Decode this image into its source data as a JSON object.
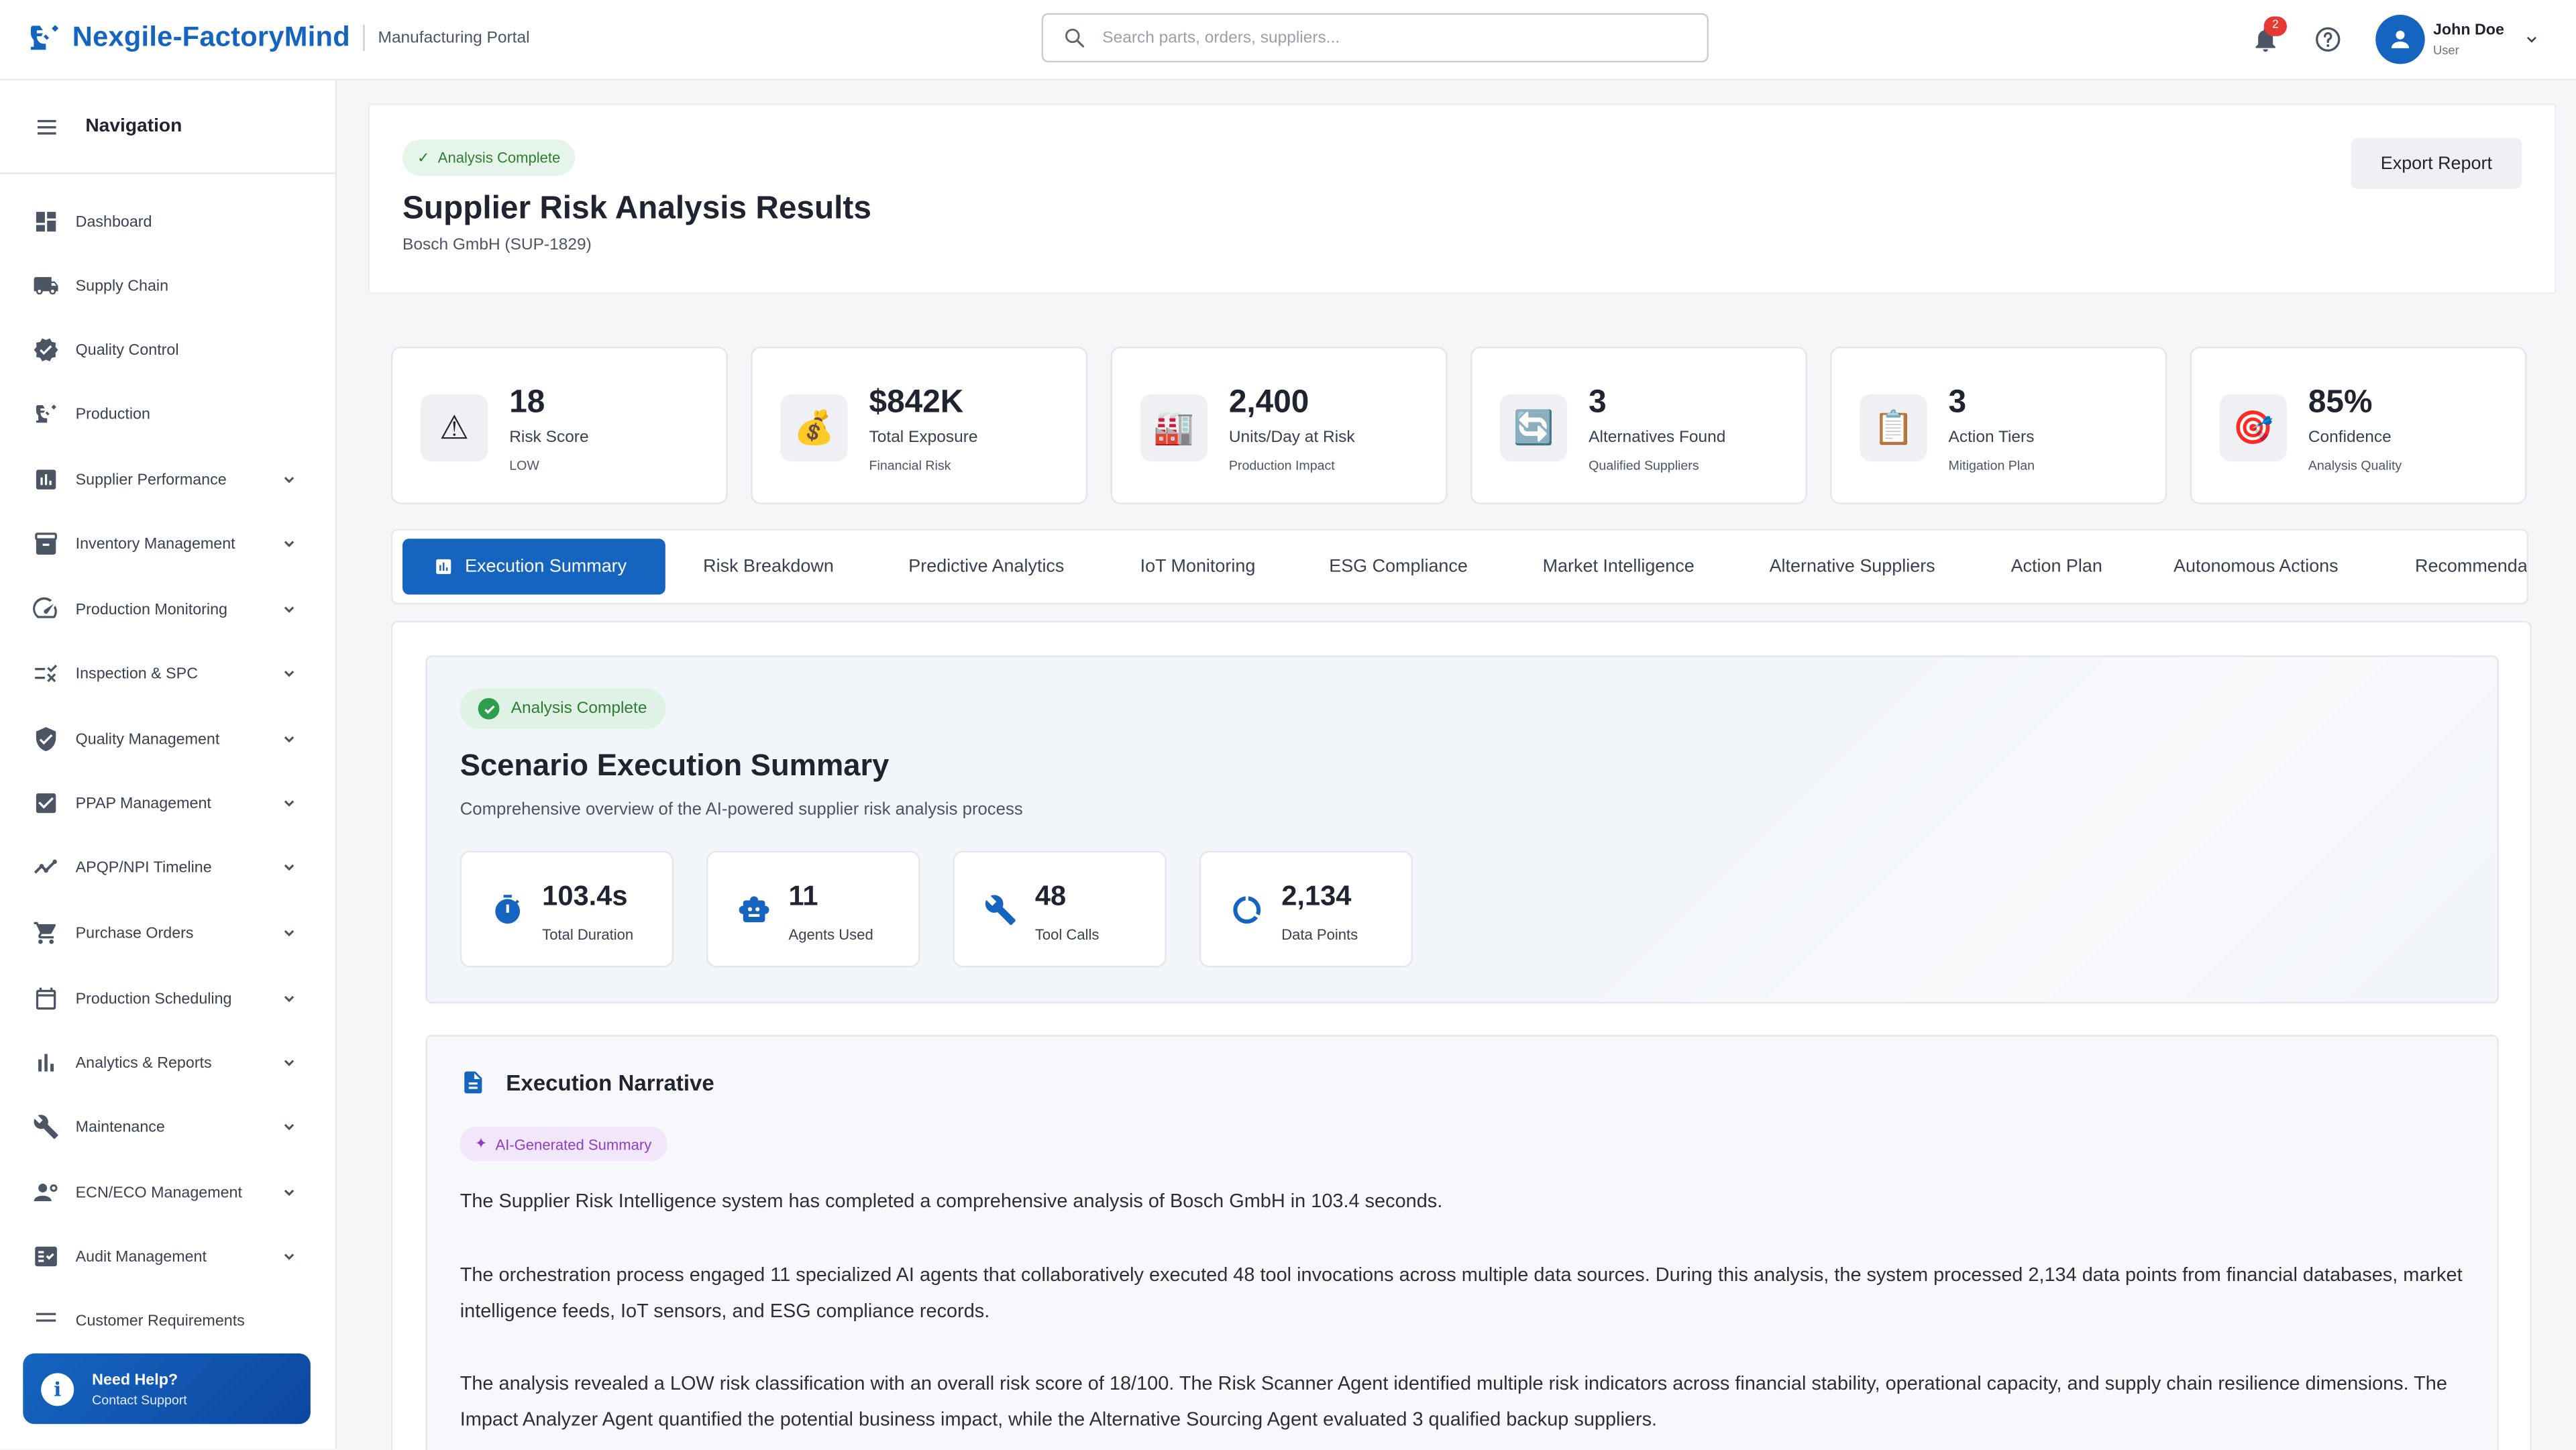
{
  "app": {
    "brand": "Nexgile-FactoryMind",
    "portal": "Manufacturing Portal",
    "accent_color": "#1565c0"
  },
  "search": {
    "placeholder": "Search parts, orders, suppliers..."
  },
  "notifications": {
    "count": "2"
  },
  "user": {
    "name": "John Doe",
    "role": "User"
  },
  "sidebar": {
    "title": "Navigation",
    "items": [
      {
        "label": "Dashboard",
        "icon": "dashboard-icon",
        "expandable": false
      },
      {
        "label": "Supply Chain",
        "icon": "truck-icon",
        "expandable": false
      },
      {
        "label": "Quality Control",
        "icon": "verified-icon",
        "expandable": false
      },
      {
        "label": "Production",
        "icon": "precision-icon",
        "expandable": false
      },
      {
        "label": "Supplier Performance",
        "icon": "assessment-icon",
        "expandable": true
      },
      {
        "label": "Inventory Management",
        "icon": "inventory-icon",
        "expandable": true
      },
      {
        "label": "Production Monitoring",
        "icon": "speed-icon",
        "expandable": true
      },
      {
        "label": "Inspection & SPC",
        "icon": "rule-icon",
        "expandable": true
      },
      {
        "label": "Quality Management",
        "icon": "shield-check-icon",
        "expandable": true
      },
      {
        "label": "PPAP Management",
        "icon": "checkbox-icon",
        "expandable": true
      },
      {
        "label": "APQP/NPI Timeline",
        "icon": "timeline-icon",
        "expandable": true
      },
      {
        "label": "Purchase Orders",
        "icon": "cart-icon",
        "expandable": true
      },
      {
        "label": "Production Scheduling",
        "icon": "calendar-icon",
        "expandable": true
      },
      {
        "label": "Analytics & Reports",
        "icon": "bar-chart-icon",
        "expandable": true
      },
      {
        "label": "Maintenance",
        "icon": "wrench-icon",
        "expandable": true
      },
      {
        "label": "ECN/ECO Management",
        "icon": "engineering-icon",
        "expandable": true
      },
      {
        "label": "Audit Management",
        "icon": "fact-check-icon",
        "expandable": true
      },
      {
        "label": "Customer Requirements",
        "icon": "requirements-icon",
        "expandable": true
      }
    ],
    "help": {
      "title": "Need Help?",
      "subtitle": "Contact Support"
    }
  },
  "header": {
    "status": "Analysis Complete",
    "title": "Supplier Risk Analysis Results",
    "subtitle": "Bosch GmbH (SUP-1829)",
    "export_label": "Export Report"
  },
  "kpis": [
    {
      "value": "18",
      "label": "Risk Score",
      "sub": "LOW",
      "emoji": "⚠"
    },
    {
      "value": "$842K",
      "label": "Total Exposure",
      "sub": "Financial Risk",
      "emoji": "💰"
    },
    {
      "value": "2,400",
      "label": "Units/Day at Risk",
      "sub": "Production Impact",
      "emoji": "🏭"
    },
    {
      "value": "3",
      "label": "Alternatives Found",
      "sub": "Qualified Suppliers",
      "emoji": "🔄"
    },
    {
      "value": "3",
      "label": "Action Tiers",
      "sub": "Mitigation Plan",
      "emoji": "📋"
    },
    {
      "value": "85%",
      "label": "Confidence",
      "sub": "Analysis Quality",
      "emoji": "🎯"
    }
  ],
  "tabs": [
    "Execution Summary",
    "Risk Breakdown",
    "Predictive Analytics",
    "IoT Monitoring",
    "ESG Compliance",
    "Market Intelligence",
    "Alternative Suppliers",
    "Action Plan",
    "Autonomous Actions",
    "Recommendations"
  ],
  "summary": {
    "status": "Analysis Complete",
    "title": "Scenario Execution Summary",
    "subtitle": "Comprehensive overview of the AI-powered supplier risk analysis process",
    "stats": [
      {
        "value": "103.4s",
        "label": "Total Duration",
        "icon": "timer-icon"
      },
      {
        "value": "11",
        "label": "Agents Used",
        "icon": "robot-icon"
      },
      {
        "value": "48",
        "label": "Tool Calls",
        "icon": "wrench-icon"
      },
      {
        "value": "2,134",
        "label": "Data Points",
        "icon": "donut-icon"
      }
    ]
  },
  "narrative": {
    "title": "Execution Narrative",
    "badge": "AI-Generated Summary",
    "paragraphs": [
      "The Supplier Risk Intelligence system has completed a comprehensive analysis of Bosch GmbH in 103.4 seconds.",
      "The orchestration process engaged 11 specialized AI agents that collaboratively executed 48 tool invocations across multiple data sources. During this analysis, the system processed 2,134 data points from financial databases, market intelligence feeds, IoT sensors, and ESG compliance records.",
      "The analysis revealed a LOW risk classification with an overall risk score of 18/100. The Risk Scanner Agent identified multiple risk indicators across financial stability, operational capacity, and supply chain resilience dimensions. The Impact Analyzer Agent quantified the potential business impact, while the Alternative Sourcing Agent evaluated 3 qualified backup suppliers."
    ]
  }
}
